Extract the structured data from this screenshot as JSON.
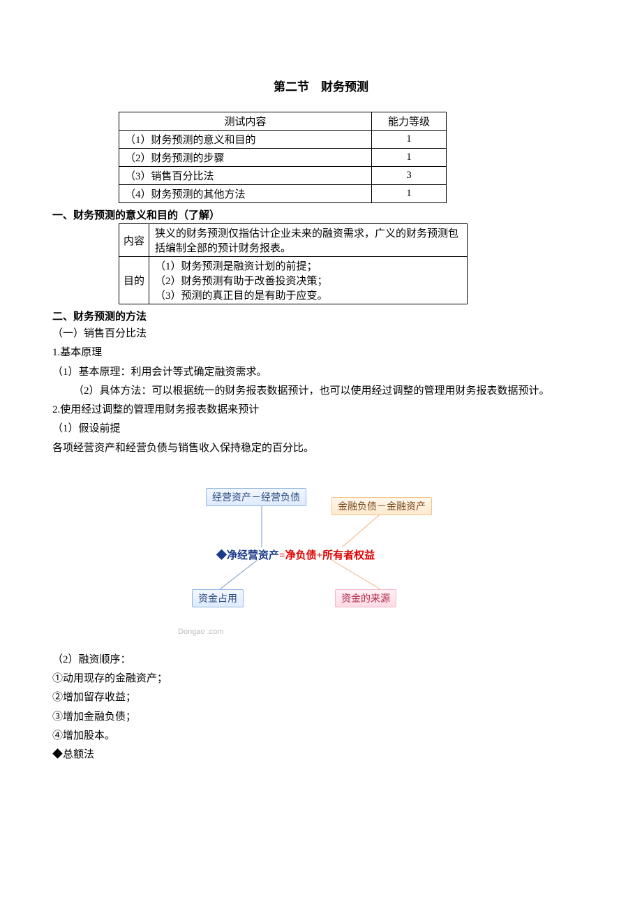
{
  "title": "第二节　财务预测",
  "table1": {
    "header": {
      "content": "测试内容",
      "level": "能力等级"
    },
    "rows": [
      {
        "content": "（1）财务预测的意义和目的",
        "level": "1"
      },
      {
        "content": "（2）财务预测的步骤",
        "level": "1"
      },
      {
        "content": "（3）销售百分比法",
        "level": "3"
      },
      {
        "content": "（4）财务预测的其他方法",
        "level": "1"
      }
    ]
  },
  "sec1_title": "一、财务预测的意义和目的（了解）",
  "table2": {
    "rows": [
      {
        "label": "内容",
        "text": "狭义的财务预测仅指估计企业未来的融资需求，广义的财务预测包括编制全部的预计财务报表。"
      },
      {
        "label": "目的",
        "line1": "（1）财务预测是融资计划的前提；",
        "line2": "（2）财务预测有助于改善投资决策；",
        "line3": "（3）预测的真正目的是有助于应变。"
      }
    ]
  },
  "sec2_title": "二、财务预测的方法",
  "p1": "（一）销售百分比法",
  "p2": "1.基本原理",
  "p3": "（1）基本原理：利用会计等式确定融资需求。",
  "p4": "（2）具体方法：可以根据统一的财务报表数据预计，也可以使用经过调整的管理用财务报表数据预计。",
  "p5": "2.使用经过调整的管理用财务报表数据来预计",
  "p6": "（1）假设前提",
  "p7": "各项经营资产和经营负债与销售收入保持稳定的百分比。",
  "diagram": {
    "box1": "经营资产－经营负债",
    "box2": "金融负债－金融资产",
    "formula_left": "净经营资产",
    "formula_eq": "=",
    "formula_mid": "净负债+",
    "formula_right": "所有者权益",
    "box3": "资金占用",
    "box4": "资金的来源",
    "watermark": "Dongao .com"
  },
  "p8": "（2）融资顺序：",
  "p9": "①动用现存的金融资产；",
  "p10": "②增加留存收益；",
  "p11": "③增加金融负债；",
  "p12": "④增加股本。",
  "p13": "◆总额法"
}
